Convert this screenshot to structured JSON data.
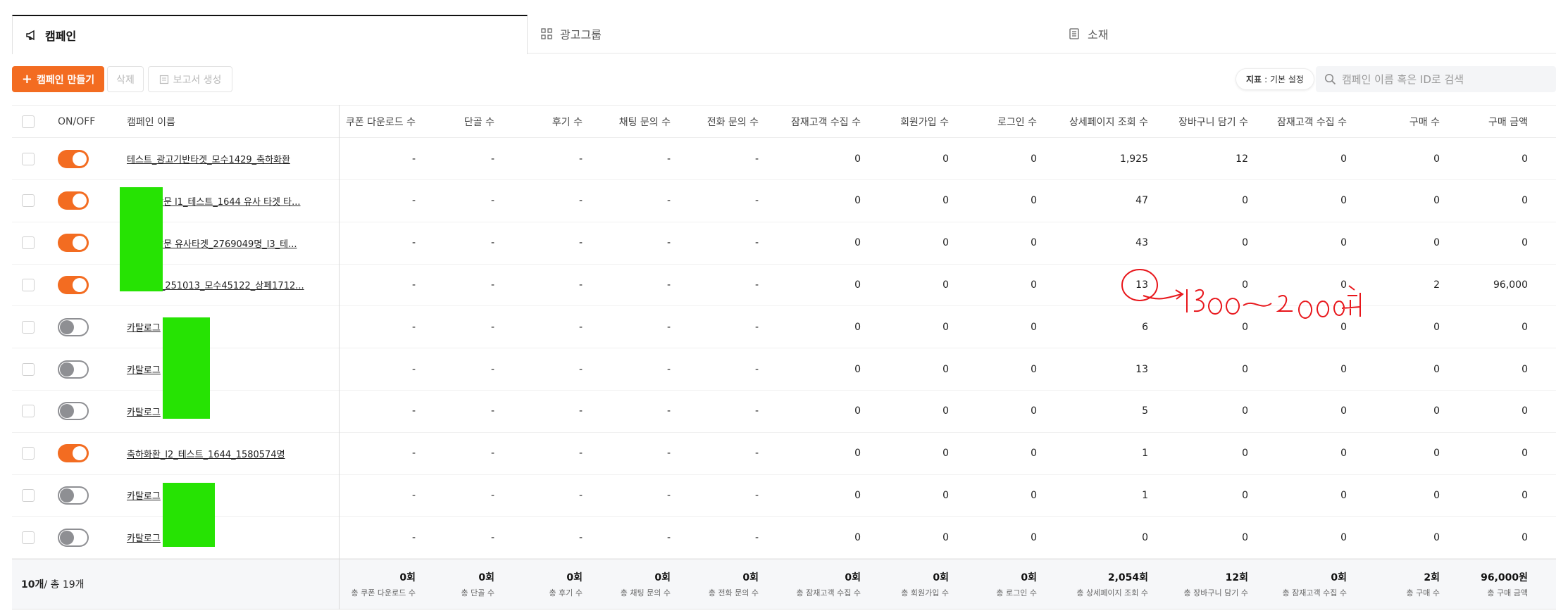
{
  "tabs": [
    {
      "label": "캠페인",
      "icon": "megaphone-icon",
      "active": true
    },
    {
      "label": "광고그룹",
      "icon": "grid-icon",
      "active": false
    },
    {
      "label": "소재",
      "icon": "document-icon",
      "active": false
    }
  ],
  "toolbar": {
    "create_label": "캠페인 만들기",
    "delete_label": "삭제",
    "report_label": "보고서 생성",
    "metric_key": "지표",
    "metric_value": ": 기본 설정",
    "search_placeholder": "캠페인 이름 혹은 ID로 검색"
  },
  "columns": [
    "ON/OFF",
    "캠페인 이름",
    "쿠폰 다운로드 수",
    "단골 수",
    "후기 수",
    "채팅 문의 수",
    "전화 문의 수",
    "잠재고객 수집 수",
    "회원가입 수",
    "로그인 수",
    "상세페이지 조회 수",
    "장바구니 담기 수",
    "잠재고객 수집 수",
    "구매 수",
    "구매 금액"
  ],
  "rows": [
    {
      "on": true,
      "name": "테스트_광고기반타겟_모수1429_축하화환",
      "values": [
        "-",
        "-",
        "-",
        "-",
        "-",
        "0",
        "0",
        "0",
        "1,925",
        "12",
        "0",
        "0",
        "0"
      ]
    },
    {
      "on": true,
      "name": "자사몰 방문 l1_테스트_1644 유사 타겟 타...",
      "values": [
        "-",
        "-",
        "-",
        "-",
        "-",
        "0",
        "0",
        "0",
        "47",
        "0",
        "0",
        "0",
        "0"
      ]
    },
    {
      "on": true,
      "name": "자사몰 방문 유사타겟_2769049명_l3_테...",
      "values": [
        "-",
        "-",
        "-",
        "-",
        "-",
        "0",
        "0",
        "0",
        "43",
        "0",
        "0",
        "0",
        "0"
      ]
    },
    {
      "on": true,
      "name": "타겟모수_251013_모수45122_상페1712...",
      "values": [
        "-",
        "-",
        "-",
        "-",
        "-",
        "0",
        "0",
        "0",
        "13",
        "0",
        "0",
        "2",
        "96,000"
      ]
    },
    {
      "on": false,
      "name": "카탈로그",
      "values": [
        "-",
        "-",
        "-",
        "-",
        "-",
        "0",
        "0",
        "0",
        "6",
        "0",
        "0",
        "0",
        "0"
      ]
    },
    {
      "on": false,
      "name": "카탈로그",
      "values": [
        "-",
        "-",
        "-",
        "-",
        "-",
        "0",
        "0",
        "0",
        "13",
        "0",
        "0",
        "0",
        "0"
      ]
    },
    {
      "on": false,
      "name": "카탈로그",
      "values": [
        "-",
        "-",
        "-",
        "-",
        "-",
        "0",
        "0",
        "0",
        "5",
        "0",
        "0",
        "0",
        "0"
      ]
    },
    {
      "on": true,
      "name": "축하화환_l2_테스트_1644_1580574명",
      "values": [
        "-",
        "-",
        "-",
        "-",
        "-",
        "0",
        "0",
        "0",
        "1",
        "0",
        "0",
        "0",
        "0"
      ]
    },
    {
      "on": false,
      "name": "카탈로그",
      "values": [
        "-",
        "-",
        "-",
        "-",
        "-",
        "0",
        "0",
        "0",
        "1",
        "0",
        "0",
        "0",
        "0"
      ]
    },
    {
      "on": false,
      "name": "카탈로그",
      "values": [
        "-",
        "-",
        "-",
        "-",
        "-",
        "0",
        "0",
        "0",
        "0",
        "0",
        "0",
        "0",
        "0"
      ]
    }
  ],
  "footer": {
    "count_bold": "10개",
    "count_rest": " / 총 19개",
    "totals": [
      {
        "value": "0회",
        "label": "총 쿠폰 다운로드 수"
      },
      {
        "value": "0회",
        "label": "총 단골 수"
      },
      {
        "value": "0회",
        "label": "총 후기 수"
      },
      {
        "value": "0회",
        "label": "총 채팅 문의 수"
      },
      {
        "value": "0회",
        "label": "총 전화 문의 수"
      },
      {
        "value": "0회",
        "label": "총 잠재고객 수집 수"
      },
      {
        "value": "0회",
        "label": "총 회원가입 수"
      },
      {
        "value": "0회",
        "label": "총 로그인 수"
      },
      {
        "value": "2,054회",
        "label": "총 상세페이지 조회 수"
      },
      {
        "value": "12회",
        "label": "총 장바구니 담기 수"
      },
      {
        "value": "0회",
        "label": "총 잠재고객 수집 수"
      },
      {
        "value": "2회",
        "label": "총 구매 수"
      },
      {
        "value": "96,000원",
        "label": "총 구매 금액"
      }
    ]
  },
  "colors": {
    "accent": "#f36c21",
    "mask": "#26e303",
    "annotation": "#e8161b"
  }
}
